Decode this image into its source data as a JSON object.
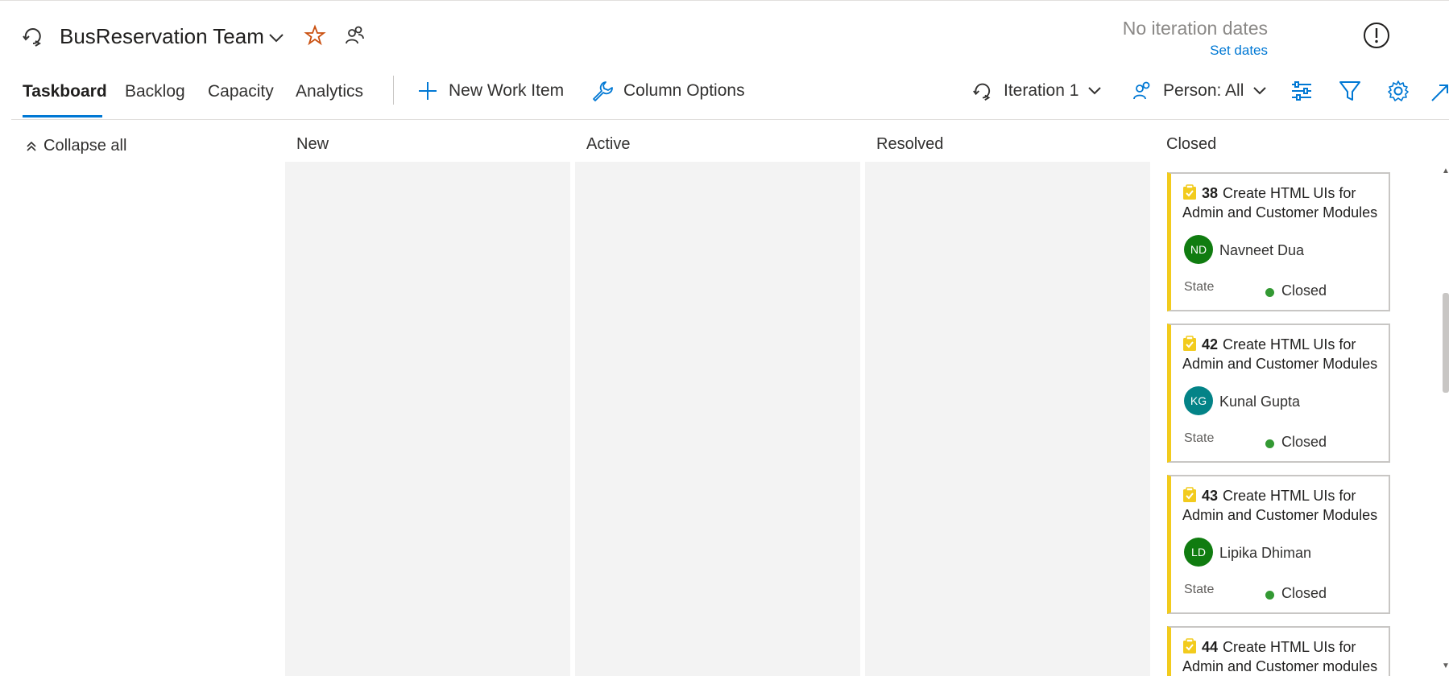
{
  "header": {
    "team_name": "BusReservation Team",
    "no_iteration_dates": "No iteration dates",
    "set_dates": "Set dates"
  },
  "nav": {
    "tabs": [
      {
        "label": "Taskboard",
        "active": true
      },
      {
        "label": "Backlog",
        "active": false
      },
      {
        "label": "Capacity",
        "active": false
      },
      {
        "label": "Analytics",
        "active": false
      }
    ],
    "new_work_item": "New Work Item",
    "column_options": "Column Options",
    "iteration": "Iteration 1",
    "person_filter": "Person: All"
  },
  "board": {
    "collapse_all": "Collapse all",
    "columns": [
      "New",
      "Active",
      "Resolved",
      "Closed"
    ],
    "cards": [
      {
        "id": "38",
        "title": "Create HTML UIs for Admin and Customer Modules",
        "initials": "ND",
        "assignee": "Navneet Dua",
        "avatar_color": "#107c10",
        "state_label": "State",
        "state": "Closed"
      },
      {
        "id": "42",
        "title": "Create HTML UIs for Admin and Customer Modules",
        "initials": "KG",
        "assignee": "Kunal Gupta",
        "avatar_color": "#038387",
        "state_label": "State",
        "state": "Closed"
      },
      {
        "id": "43",
        "title": "Create HTML UIs for Admin and Customer Modules",
        "initials": "LD",
        "assignee": "Lipika Dhiman",
        "avatar_color": "#107c10",
        "state_label": "State",
        "state": "Closed"
      },
      {
        "id": "44",
        "title": "Create HTML UIs for Admin and Customer modules"
      }
    ]
  },
  "colors": {
    "accent": "#0078d4",
    "card_border": "#f2cb1d",
    "state_closed": "#339933",
    "star": "#ca5010"
  },
  "icons": [
    "iteration-icon",
    "chevron-down-icon",
    "star-icon",
    "team-members-icon",
    "alert-icon",
    "plus-icon",
    "wrench-icon",
    "person-icon",
    "settings-sliders-icon",
    "filter-icon",
    "gear-icon",
    "fullscreen-icon",
    "collapse-icon",
    "task-icon"
  ]
}
